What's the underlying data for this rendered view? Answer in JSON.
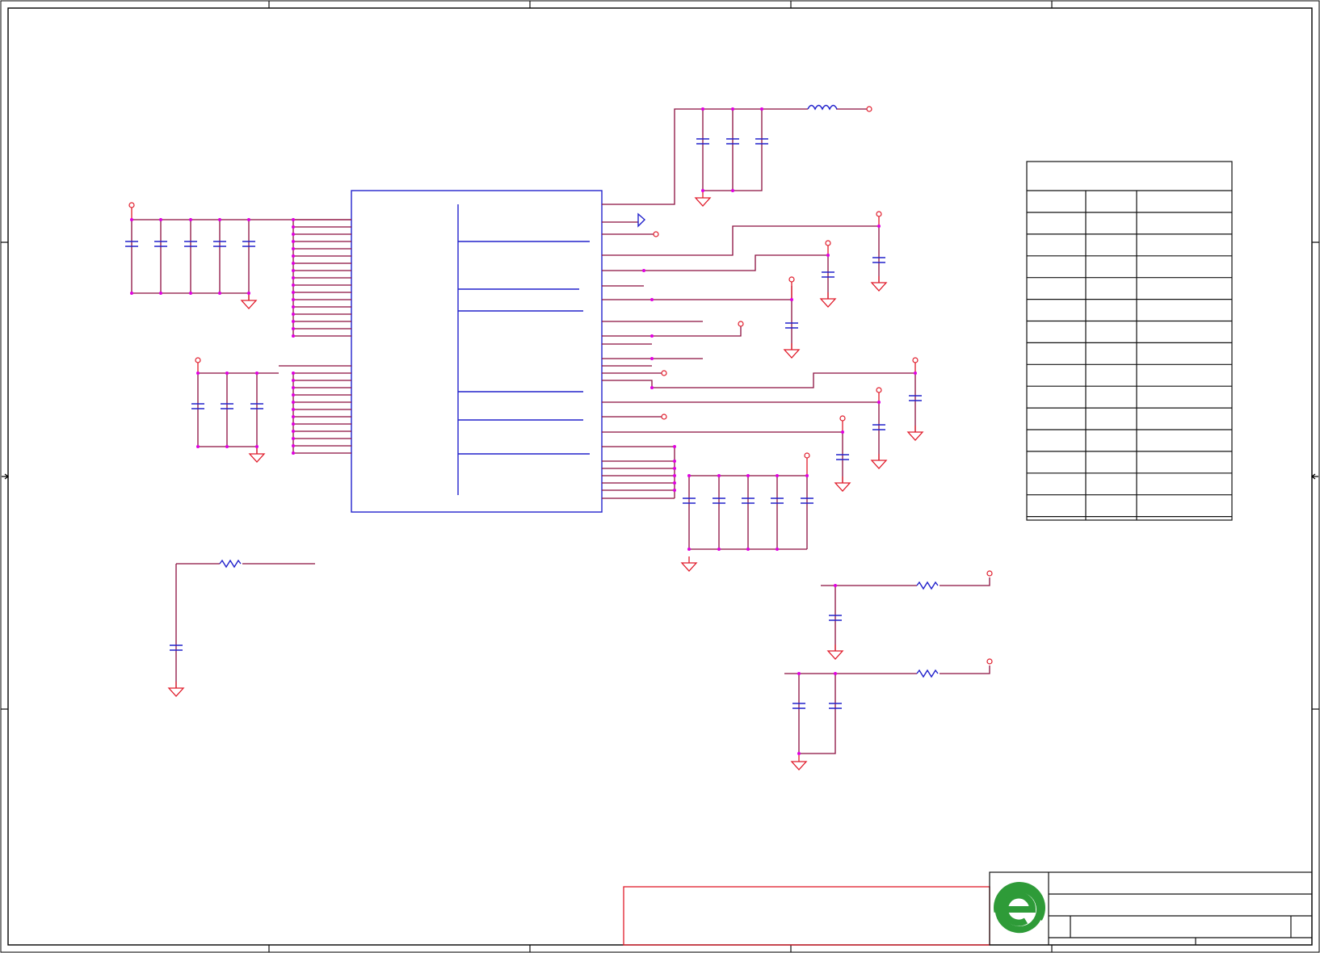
{
  "colors": {
    "border": "#000000",
    "wire": "#8b0f3f",
    "component": "#2222cc",
    "junction": "#e000e0",
    "power": "#e01b2a",
    "logo": "#2e9b38"
  },
  "icons": {
    "ground": "ground-icon",
    "power_flag": "power-port-icon",
    "logo": "company-logo-icon"
  }
}
